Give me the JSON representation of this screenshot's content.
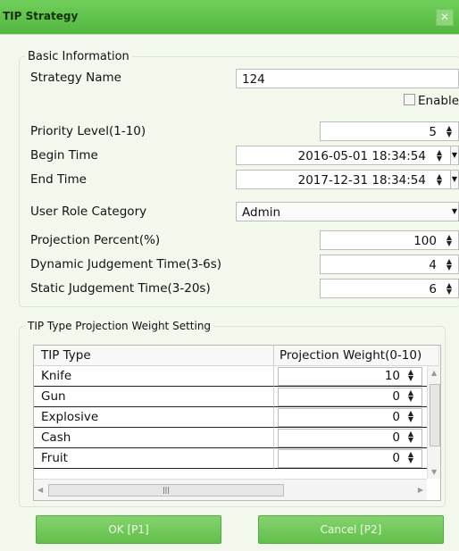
{
  "window": {
    "title": "TIP Strategy",
    "close_glyph": "✕"
  },
  "basic_info": {
    "legend": "Basic Information",
    "strategy_name_label": "Strategy Name",
    "strategy_name_value": "124",
    "enable_label": "Enable",
    "priority_label": "Priority Level(1-10)",
    "priority_value": "5",
    "begin_label": "Begin Time",
    "begin_value": "2016-05-01 18:34:54",
    "end_label": "End Time",
    "end_value": "2017-12-31 18:34:54",
    "role_label": "User Role Category",
    "role_value": "Admin",
    "projection_label": "Projection Percent(%)",
    "projection_value": "100",
    "dynamic_label": "Dynamic Judgement Time(3-6s)",
    "dynamic_value": "4",
    "static_label": "Static Judgement Time(3-20s)",
    "static_value": "6"
  },
  "tip_weight": {
    "legend": "TIP Type Projection Weight Setting",
    "col_type": "TIP Type",
    "col_weight": "Projection Weight(0-10)",
    "rows": [
      {
        "type": "Knife",
        "weight": "10"
      },
      {
        "type": "Gun",
        "weight": "0"
      },
      {
        "type": "Explosive",
        "weight": "0"
      },
      {
        "type": "Cash",
        "weight": "0"
      },
      {
        "type": "Fruit",
        "weight": "0"
      }
    ]
  },
  "buttons": {
    "ok": "OK [P1]",
    "cancel": "Cancel [P2]"
  },
  "icons": {
    "spinner": "spinner-updown-icon",
    "dropdown": "chevron-down-icon",
    "close": "close-icon"
  }
}
